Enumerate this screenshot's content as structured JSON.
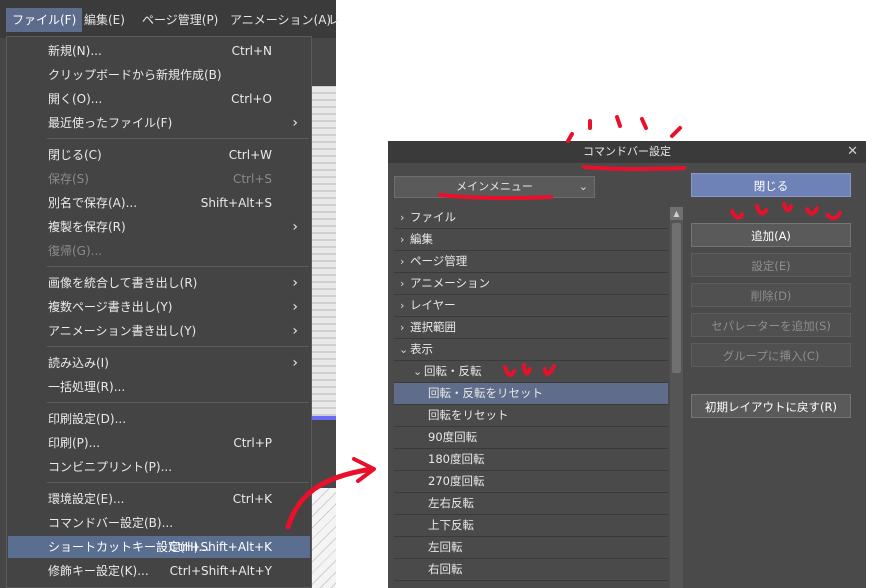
{
  "menubar": {
    "items": [
      "ファイル(F)",
      "編集(E)",
      "ページ管理(P)",
      "アニメーション(A)",
      "レ"
    ]
  },
  "file_menu": {
    "items": [
      {
        "label": "新規(N)...",
        "shortcut": "Ctrl+N"
      },
      {
        "label": "クリップボードから新規作成(B)",
        "shortcut": ""
      },
      {
        "label": "開く(O)...",
        "shortcut": "Ctrl+O"
      },
      {
        "label": "最近使ったファイル(F)",
        "shortcut": "",
        "submenu": "›"
      },
      {
        "label": "閉じる(C)",
        "shortcut": "Ctrl+W"
      },
      {
        "label": "保存(S)",
        "shortcut": "Ctrl+S",
        "disabled": true
      },
      {
        "label": "別名で保存(A)...",
        "shortcut": "Shift+Alt+S"
      },
      {
        "label": "複製を保存(R)",
        "shortcut": "",
        "submenu": "›"
      },
      {
        "label": "復帰(G)...",
        "shortcut": "",
        "disabled": true
      },
      {
        "label": "画像を統合して書き出し(R)",
        "shortcut": "",
        "submenu": "›"
      },
      {
        "label": "複数ページ書き出し(Y)",
        "shortcut": "",
        "submenu": "›"
      },
      {
        "label": "アニメーション書き出し(Y)",
        "shortcut": "",
        "submenu": "›"
      },
      {
        "label": "読み込み(I)",
        "shortcut": "",
        "submenu": "›"
      },
      {
        "label": "一括処理(R)...",
        "shortcut": ""
      },
      {
        "label": "印刷設定(D)...",
        "shortcut": ""
      },
      {
        "label": "印刷(P)...",
        "shortcut": "Ctrl+P"
      },
      {
        "label": "コンビニプリント(P)...",
        "shortcut": ""
      },
      {
        "label": "環境設定(E)...",
        "shortcut": "Ctrl+K"
      },
      {
        "label": "コマンドバー設定(B)...",
        "shortcut": ""
      },
      {
        "label": "ショートカットキー設定(H)...",
        "shortcut": "Ctrl+Shift+Alt+K",
        "highlighted": true
      },
      {
        "label": "修飾キー設定(K)...",
        "shortcut": "Ctrl+Shift+Alt+Y"
      }
    ]
  },
  "dialog": {
    "title": "コマンドバー設定",
    "close_glyph": "✕",
    "select_value": "メインメニュー",
    "tree": [
      {
        "label": "ファイル",
        "expander": "›"
      },
      {
        "label": "編集",
        "expander": "›"
      },
      {
        "label": "ページ管理",
        "expander": "›"
      },
      {
        "label": "アニメーション",
        "expander": "›"
      },
      {
        "label": "レイヤー",
        "expander": "›"
      },
      {
        "label": "選択範囲",
        "expander": "›"
      },
      {
        "label": "表示",
        "expander": "⌄"
      },
      {
        "label": "回転・反転",
        "expander": "⌄"
      },
      {
        "label": "回転・反転をリセット",
        "selected": true
      },
      {
        "label": "回転をリセット"
      },
      {
        "label": "90度回転"
      },
      {
        "label": "180度回転"
      },
      {
        "label": "270度回転"
      },
      {
        "label": "左右反転"
      },
      {
        "label": "上下反転"
      },
      {
        "label": "左回転"
      },
      {
        "label": "右回転"
      }
    ],
    "buttons": {
      "close": "閉じる",
      "add": "追加(A)",
      "settings": "設定(E)",
      "delete": "削除(D)",
      "add_separator": "セパレーターを追加(S)",
      "insert_group": "グループに挿入(C)",
      "reset_layout": "初期レイアウトに戻す(R)"
    }
  },
  "colors": {
    "annotation": "#e8102a",
    "highlight": "#5a6e8f",
    "primary_button": "#6e82b8"
  }
}
